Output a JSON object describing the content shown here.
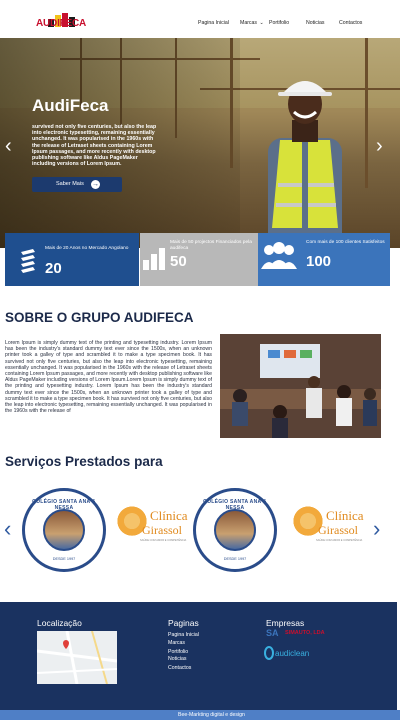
{
  "header": {
    "logo_text": "AUDIFECA",
    "nav": [
      {
        "label": "Pagina Inicial"
      },
      {
        "label": "Marcas"
      },
      {
        "label": "Portifolio"
      },
      {
        "label": "Noticias"
      },
      {
        "label": "Contactos"
      }
    ]
  },
  "hero": {
    "title": "AudiFeca",
    "text": "survived not only five centuries, but also the leap into electronic typesetting, remaining essentially unchanged. It was popularised in the 1960s with the release of Letraset sheets containing Lorem Ipsum passages, and more recently with desktop publishing software like Aldus PageMaker including versions of Lorem Ipsum.",
    "button_label": "Saber Mais"
  },
  "stats": [
    {
      "text": "Mais de 20 Anos no Mercado Angolano",
      "number": "20",
      "icon": "building-icon"
    },
    {
      "text": "Mais de 50 projectos Financiados pela audifeca",
      "number": "50",
      "icon": "bar-chart-icon"
    },
    {
      "text": "Com mais de 100 clientes Satisfeitos",
      "number": "100",
      "icon": "people-icon"
    }
  ],
  "about": {
    "title": "SOBRE O GRUPO AUDIFECA",
    "text": "Lorem Ipsum is simply dummy text of the printing and typesetting industry. Lorem Ipsum has been the industry's standard dummy text ever since the 1500s, when an unknown printer took a galley of type and scrambled it to make a type specimen book. It has survived not only five centuries, but also the leap into electronic typesetting, remaining essentially unchanged. It was popularised in the 1960s with the release of Letraset sheets containing Lorem Ipsum passages, and more recently with desktop publishing software like Aldus PageMaker including versions of Lorem Ipsum.Lorem Ipsum is simply dummy text of the printing and typesetting industry. Lorem Ipsum has been the industry's standard dummy text ever since the 1500s, when an unknown printer took a galley of type and scrambled it to make a type specimen book. It has survived not only five centuries, but also the leap into electronic typesetting, remaining essentially unchanged. It was popularised in the 1960s with the release of"
  },
  "services": {
    "title": "Serviços Prestados para",
    "clients": [
      {
        "name_arc": "COLÉGIO SANTA ANA & NESSA",
        "year": "DESDE 1997"
      },
      {
        "name1": "Clínica",
        "name2": "Girassol",
        "sub": "SAÚDE COM AMOR E COMPETÊNCIA"
      },
      {
        "name_arc": "COLÉGIO SANTA ANA & NESSA",
        "year": "DESDE 1997"
      },
      {
        "name1": "Clínica",
        "name2": "Girassol",
        "sub": "SAÚDE COM AMOR E COMPETÊNCIA"
      }
    ]
  },
  "footer": {
    "location_title": "Localização",
    "pages_title": "Paginas",
    "pages": [
      "Pagina Inicial",
      "Marcas",
      "Portifolio",
      "Noticias",
      "Contactos"
    ],
    "companies_title": "Empresas",
    "company1": "SIMAUTO, LDA",
    "company2": "audiclean",
    "credit": "Bee-Markting digital e design"
  },
  "colors": {
    "primary": "#1f4f8f",
    "footer": "#1a3260",
    "accent": "#4f7fc6",
    "gray": "#b8b8b8"
  }
}
